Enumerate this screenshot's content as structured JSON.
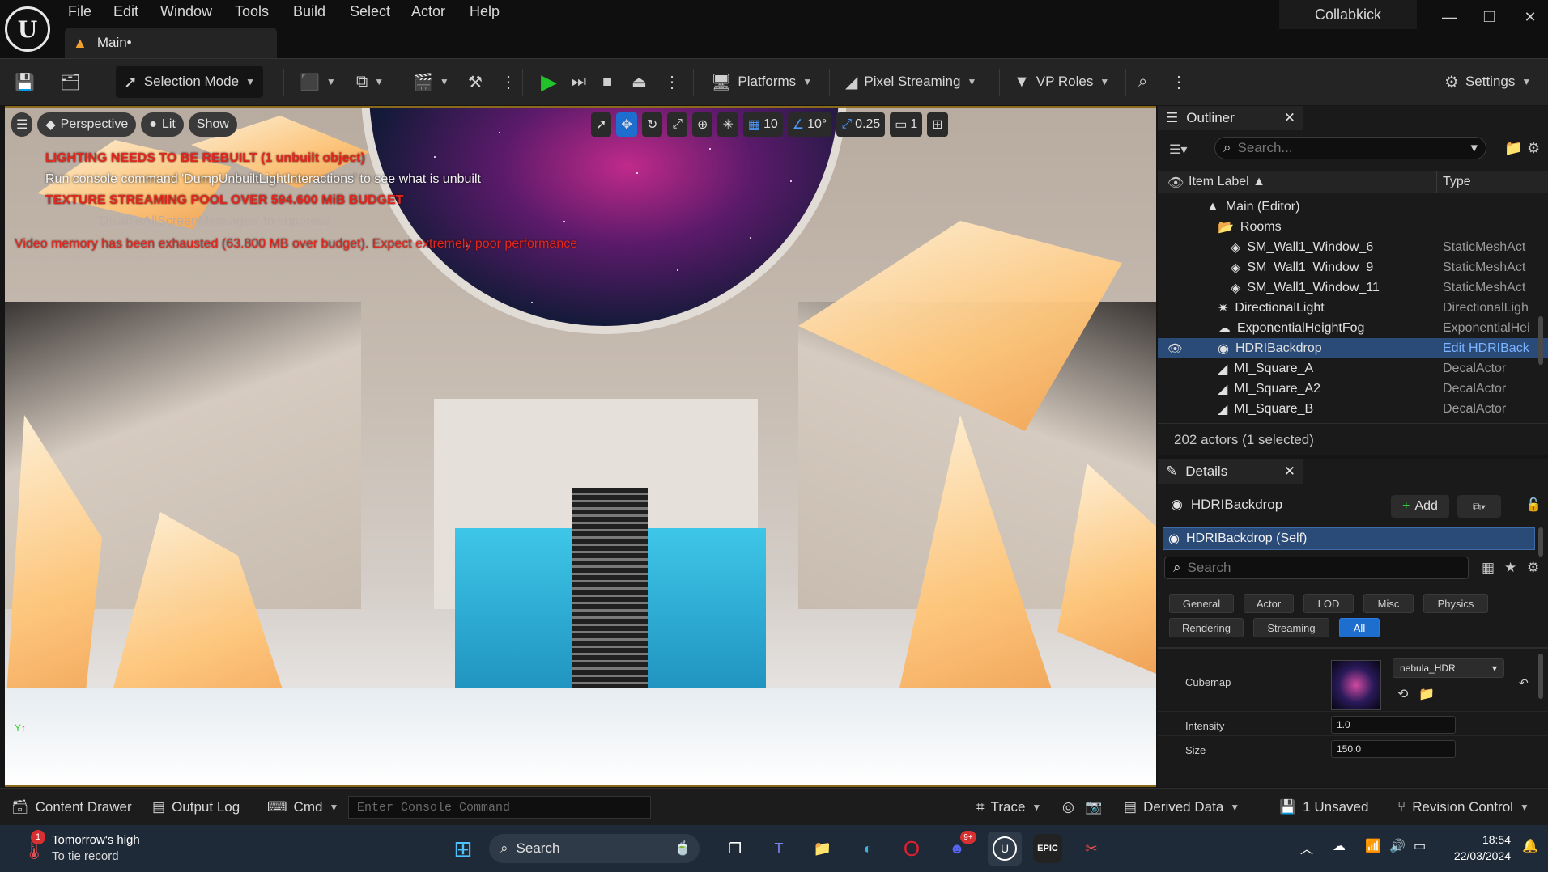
{
  "menu": {
    "items": [
      "File",
      "Edit",
      "Window",
      "Tools",
      "Build",
      "Select",
      "Actor",
      "Help"
    ]
  },
  "tab": {
    "label": "Main•"
  },
  "project": {
    "name": "Collabkick"
  },
  "toolbar": {
    "selection_mode": "Selection Mode",
    "platforms": "Platforms",
    "pixel_streaming": "Pixel Streaming",
    "vp_roles": "VP Roles",
    "settings": "Settings"
  },
  "viewport": {
    "perspective": "Perspective",
    "lit": "Lit",
    "show": "Show",
    "grid_snap": "10",
    "rotation_snap": "10°",
    "scale_snap": "0.25",
    "camera_speed": "1",
    "messages": {
      "lighting": "LIGHTING NEEDS TO BE REBUILT (1 unbuilt object)",
      "console": "Run console command 'DumpUnbuiltLightInteractions' to see what is unbuilt",
      "texture": "TEXTURE STREAMING POOL OVER 594.600 MiB BUDGET",
      "suppress": "'DisableAllScreenMessages' to suppress",
      "video": "Video memory has been exhausted (63.800 MB over budget). Expect extremely poor performance"
    }
  },
  "outliner": {
    "tab": "Outliner",
    "search_placeholder": "Search...",
    "col_label": "Item Label",
    "col_type": "Type",
    "rows": [
      {
        "label": "Main (Editor)",
        "type": ""
      },
      {
        "label": "Rooms",
        "type": ""
      },
      {
        "label": "SM_Wall1_Window_6",
        "type": "StaticMeshAct"
      },
      {
        "label": "SM_Wall1_Window_9",
        "type": "StaticMeshAct"
      },
      {
        "label": "SM_Wall1_Window_11",
        "type": "StaticMeshAct"
      },
      {
        "label": "DirectionalLight",
        "type": "DirectionalLigh"
      },
      {
        "label": "ExponentialHeightFog",
        "type": "ExponentialHei"
      },
      {
        "label": "HDRIBackdrop",
        "type": "Edit HDRIBack"
      },
      {
        "label": "MI_Square_A",
        "type": "DecalActor"
      },
      {
        "label": "MI_Square_A2",
        "type": "DecalActor"
      },
      {
        "label": "MI_Square_B",
        "type": "DecalActor"
      }
    ],
    "count": "202 actors (1 selected)"
  },
  "details": {
    "tab": "Details",
    "actor_name": "HDRIBackdrop",
    "add_label": "Add",
    "self_label": "HDRIBackdrop (Self)",
    "search_placeholder": "Search",
    "filters": [
      "General",
      "Actor",
      "LOD",
      "Misc",
      "Physics",
      "Rendering",
      "Streaming",
      "All"
    ],
    "cubemap_label": "Cubemap",
    "cubemap_value": "nebula_HDR",
    "intensity_label": "Intensity",
    "intensity_value": "1.0",
    "size_label": "Size",
    "size_value": "150.0"
  },
  "statusbar": {
    "content_drawer": "Content Drawer",
    "output_log": "Output Log",
    "cmd": "Cmd",
    "console_placeholder": "Enter Console Command",
    "trace": "Trace",
    "derived_data": "Derived Data",
    "unsaved": "1 Unsaved",
    "revision_control": "Revision Control"
  },
  "taskbar": {
    "weather_title": "Tomorrow's high",
    "weather_sub": "To tie record",
    "weather_badge": "1",
    "search": "Search",
    "discord_badge": "9+",
    "time": "18:54",
    "date": "22/03/2024"
  },
  "colors": {
    "accent": "#1e6ed0",
    "selection": "#2a4a78",
    "play": "#22c22a",
    "warning": "#e0281e"
  }
}
